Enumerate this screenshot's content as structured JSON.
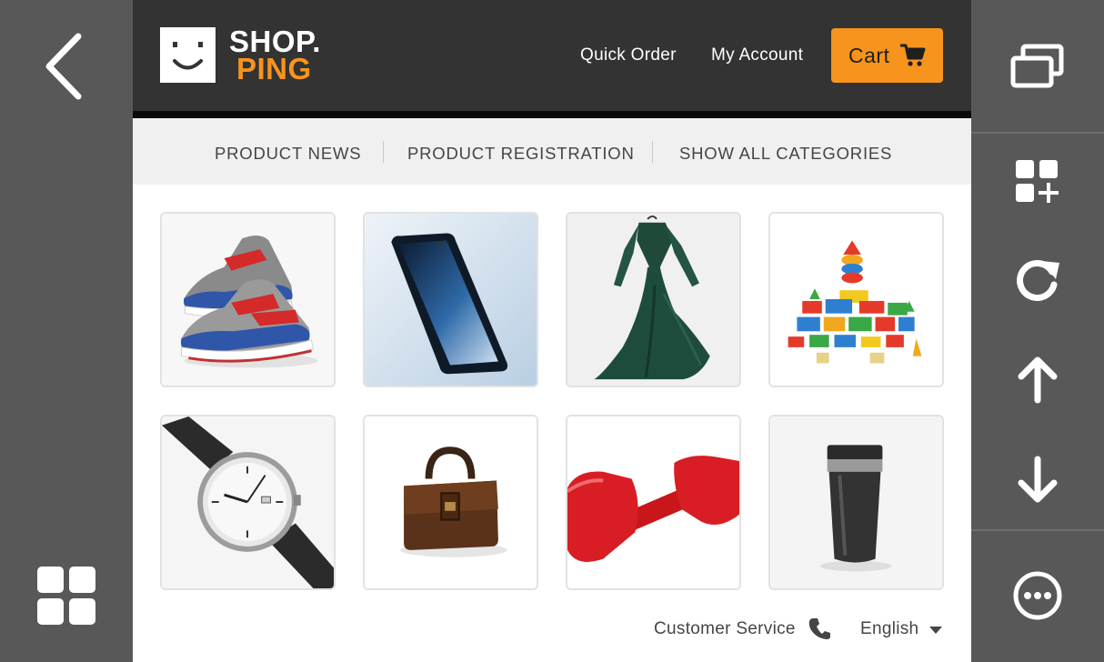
{
  "header": {
    "logo_line1": "SHOP.",
    "logo_line2": "PING",
    "quick_order": "Quick Order",
    "my_account": "My Account",
    "cart_label": "Cart"
  },
  "nav": {
    "items": [
      {
        "label": "PRODUCT NEWS"
      },
      {
        "label": "PRODUCT REGISTRATION"
      },
      {
        "label": "SHOW ALL CATEGORIES"
      }
    ]
  },
  "products": [
    {
      "icon": "sneakers-icon"
    },
    {
      "icon": "smartphone-icon"
    },
    {
      "icon": "dress-icon"
    },
    {
      "icon": "toy-blocks-icon"
    },
    {
      "icon": "wristwatch-icon"
    },
    {
      "icon": "handbag-icon"
    },
    {
      "icon": "dumbbell-icon"
    },
    {
      "icon": "tumbler-icon"
    }
  ],
  "footer": {
    "customer_service": "Customer Service",
    "language": "English"
  },
  "colors": {
    "accent": "#f7941d",
    "header_bg": "#333333",
    "rail_bg": "#585858",
    "nav_bg": "#f0f0f0"
  }
}
